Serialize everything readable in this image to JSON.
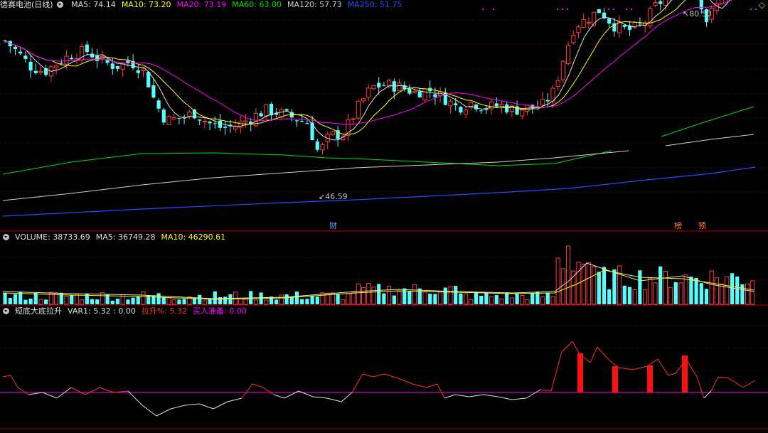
{
  "main_panel": {
    "title": "德赛电池(日线)",
    "ma": [
      {
        "label": "MA5: 74.14",
        "color": "#e0e0e0"
      },
      {
        "label": "MA10: 73.20",
        "color": "#ffff00"
      },
      {
        "label": "MA20: 73.19",
        "color": "#ff00ff"
      },
      {
        "label": "MA60: 63.00",
        "color": "#00e000"
      },
      {
        "label": "MA120: 57.73",
        "color": "#d0d0d0"
      },
      {
        "label": "MA250: 51.75",
        "color": "#2050ff"
      }
    ],
    "high_label": "80.50",
    "low_label": "46.59",
    "event_tags": [
      {
        "text": "财",
        "color": "#4aa0ff"
      },
      {
        "text": "榜",
        "color": "#ff8030"
      },
      {
        "text": "预",
        "color": "#ff8030"
      }
    ]
  },
  "volume_panel": {
    "items": [
      {
        "label": "VOLUME: 38733.69",
        "color": "#e0e0e0"
      },
      {
        "label": "MA5: 36749.28",
        "color": "#e0e0e0"
      },
      {
        "label": "MA10: 46290.61",
        "color": "#ffff00"
      }
    ]
  },
  "indicator_panel": {
    "items": [
      {
        "label": "短底大底拉升",
        "color": "#e0e0e0"
      },
      {
        "label": "VAR1: 5.32 : 0.00",
        "color": "#e0e0e0"
      },
      {
        "label": "拉升%: 5.32",
        "color": "#ff3030"
      },
      {
        "label": "买入准备: 0.00",
        "color": "#ff00ff"
      }
    ]
  },
  "colors": {
    "up": "#ff3b3b",
    "down": "#54ffff",
    "grid": "#7a0000",
    "separator": "#b00000"
  },
  "icons": [
    "collapse-icon",
    "diamond-icon"
  ]
}
